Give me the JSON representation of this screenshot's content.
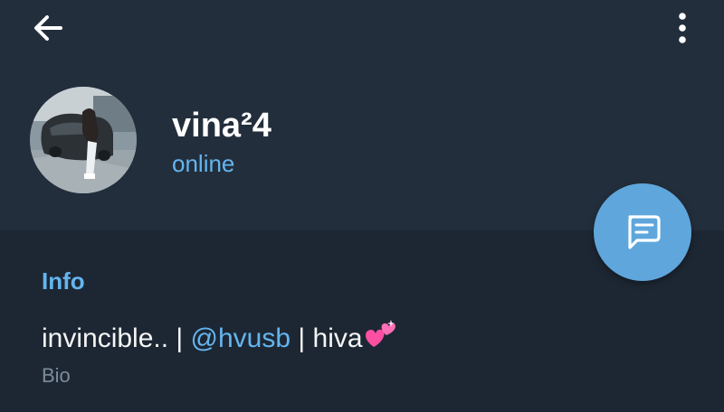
{
  "header": {
    "back_icon": "arrow-left-icon",
    "menu_icon": "more-vertical-icon"
  },
  "profile": {
    "name": "vina²4",
    "status": "online",
    "avatar_icon": "profile-photo"
  },
  "fab": {
    "icon": "message-icon"
  },
  "info": {
    "section_title": "Info",
    "bio_text_before": "invincible.. | ",
    "bio_mention": "@hvusb",
    "bio_text_after": " | hiva",
    "bio_emoji_icon": "two-hearts-icon",
    "bio_label": "Bio"
  },
  "colors": {
    "header_bg": "#232e3c",
    "page_bg": "#1d2733",
    "accent": "#64b5ef",
    "fab_bg": "#5fa6dc",
    "muted_text": "#7d8b99"
  }
}
